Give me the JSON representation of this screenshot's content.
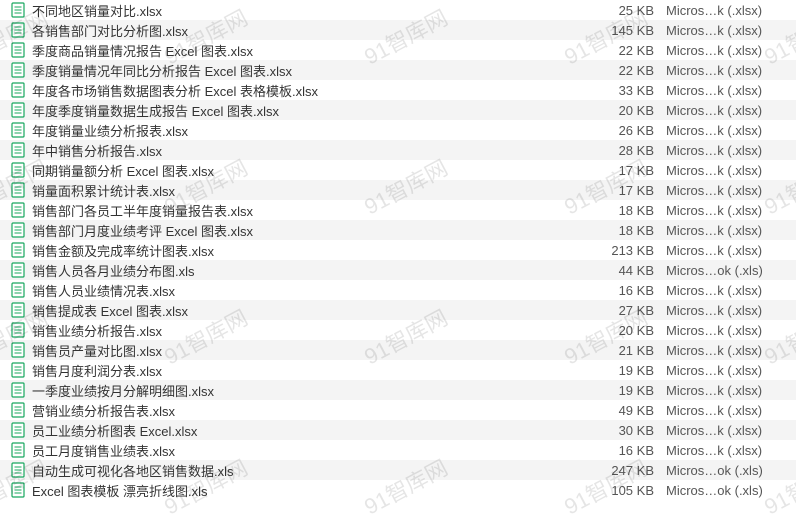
{
  "watermark_text": "91智库网",
  "accent_color": "#18a85f",
  "files": [
    {
      "name": "不同地区销量对比.xlsx",
      "size": "25 KB",
      "kind": "Micros…k (.xlsx)"
    },
    {
      "name": "各销售部门对比分析图.xlsx",
      "size": "145 KB",
      "kind": "Micros…k (.xlsx)"
    },
    {
      "name": "季度商品销量情况报告 Excel 图表.xlsx",
      "size": "22 KB",
      "kind": "Micros…k (.xlsx)"
    },
    {
      "name": "季度销量情况年同比分析报告 Excel 图表.xlsx",
      "size": "22 KB",
      "kind": "Micros…k (.xlsx)"
    },
    {
      "name": "年度各市场销售数据图表分析 Excel 表格模板.xlsx",
      "size": "33 KB",
      "kind": "Micros…k (.xlsx)"
    },
    {
      "name": "年度季度销量数据生成报告 Excel 图表.xlsx",
      "size": "20 KB",
      "kind": "Micros…k (.xlsx)"
    },
    {
      "name": "年度销量业绩分析报表.xlsx",
      "size": "26 KB",
      "kind": "Micros…k (.xlsx)"
    },
    {
      "name": "年中销售分析报告.xlsx",
      "size": "28 KB",
      "kind": "Micros…k (.xlsx)"
    },
    {
      "name": "同期销量额分析 Excel 图表.xlsx",
      "size": "17 KB",
      "kind": "Micros…k (.xlsx)"
    },
    {
      "name": "销量面积累计统计表.xlsx",
      "size": "17 KB",
      "kind": "Micros…k (.xlsx)"
    },
    {
      "name": "销售部门各员工半年度销量报告表.xlsx",
      "size": "18 KB",
      "kind": "Micros…k (.xlsx)"
    },
    {
      "name": "销售部门月度业绩考评 Excel 图表.xlsx",
      "size": "18 KB",
      "kind": "Micros…k (.xlsx)"
    },
    {
      "name": "销售金额及完成率统计图表.xlsx",
      "size": "213 KB",
      "kind": "Micros…k (.xlsx)"
    },
    {
      "name": "销售人员各月业绩分布图.xls",
      "size": "44 KB",
      "kind": "Micros…ok (.xls)"
    },
    {
      "name": "销售人员业绩情况表.xlsx",
      "size": "16 KB",
      "kind": "Micros…k (.xlsx)"
    },
    {
      "name": "销售提成表 Excel 图表.xlsx",
      "size": "27 KB",
      "kind": "Micros…k (.xlsx)"
    },
    {
      "name": "销售业绩分析报告.xlsx",
      "size": "20 KB",
      "kind": "Micros…k (.xlsx)"
    },
    {
      "name": "销售员产量对比图.xlsx",
      "size": "21 KB",
      "kind": "Micros…k (.xlsx)"
    },
    {
      "name": "销售月度利润分表.xlsx",
      "size": "19 KB",
      "kind": "Micros…k (.xlsx)"
    },
    {
      "name": "一季度业绩按月分解明细图.xlsx",
      "size": "19 KB",
      "kind": "Micros…k (.xlsx)"
    },
    {
      "name": "营销业绩分析报告表.xlsx",
      "size": "49 KB",
      "kind": "Micros…k (.xlsx)"
    },
    {
      "name": "员工业绩分析图表 Excel.xlsx",
      "size": "30 KB",
      "kind": "Micros…k (.xlsx)"
    },
    {
      "name": "员工月度销售业绩表.xlsx",
      "size": "16 KB",
      "kind": "Micros…k (.xlsx)"
    },
    {
      "name": "自动生成可视化各地区销售数据.xls",
      "size": "247 KB",
      "kind": "Micros…ok (.xls)"
    },
    {
      "name": "Excel 图表模板 漂亮折线图.xls",
      "size": "105 KB",
      "kind": "Micros…ok (.xls)"
    }
  ]
}
